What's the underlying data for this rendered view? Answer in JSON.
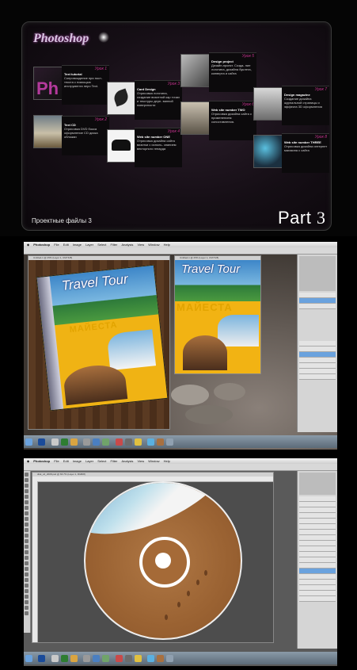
{
  "panel1": {
    "logo": "Photoshop",
    "logo_mark": "Ph",
    "projects_label": "Проектные файлы 3",
    "part_label": "Part",
    "part_number": "3",
    "lessons": [
      {
        "num": "Урок 1",
        "title": "Text tutorial",
        "desc": "Сопровождение при пост- текста с помощью инструмента перо Text."
      },
      {
        "num": "Урок 2",
        "title": "Text CD",
        "desc": "Отрисовка DVD бокса оформление CD диска обложки"
      },
      {
        "num": "Урок 3",
        "title": "Card Design",
        "desc": "Отрисовка логотипа, создание визитной кар точки и текстуры дере- вянной поверхности"
      },
      {
        "num": "Урок 4",
        "title": "Web site number ONE",
        "desc": "Отрисовка дизайна сайта визитки с исполь- знанием векторного гепарда"
      },
      {
        "num": "Урок 5",
        "title": "Design project",
        "desc": "Дизайн-проект. Созда- ние логотипа, дизайна буклета, конверта и сайта"
      },
      {
        "num": "Урок 6",
        "title": "Web site number TWO",
        "desc": "Отрисовка дизайна сайта с применением сопоставления."
      },
      {
        "num": "Урок 7",
        "title": "Design magazine",
        "desc": "Создание дизайна журнальной страницы и эффекта 3D оформления"
      },
      {
        "num": "Урок 8",
        "title": "Web site number THREE",
        "desc": "Отрисовка дизайна интернет магазина с сайта"
      }
    ]
  },
  "panel2": {
    "app_name": "Photoshop",
    "menus": [
      "File",
      "Edit",
      "Image",
      "Layer",
      "Select",
      "Filter",
      "Analysis",
      "View",
      "Window",
      "Help"
    ],
    "doc_title": "Untitled-1 @ 25% (Layer 1, CMYK/8)",
    "magazine_title": "Travel Tour",
    "magazine_title_2": "Travel Tour",
    "magazine_sub": "МАЙЕСТА",
    "magazine_sub_2": "МАЙЕСТА"
  },
  "panel3": {
    "app_name": "Photoshop",
    "menus": [
      "File",
      "Edit",
      "Image",
      "Layer",
      "Select",
      "Filter",
      "Analysis",
      "View",
      "Window",
      "Help"
    ],
    "doc_title": "disk_cd_2008.psd @ 66.7% (Layer 1, RGB/8)"
  },
  "colors": {
    "accent": "#c7338f",
    "ps_blue": "#6aa2de",
    "gold": "#e2a400"
  },
  "icons": [
    "photoshop-icon",
    "finder-icon",
    "dock-icons"
  ]
}
